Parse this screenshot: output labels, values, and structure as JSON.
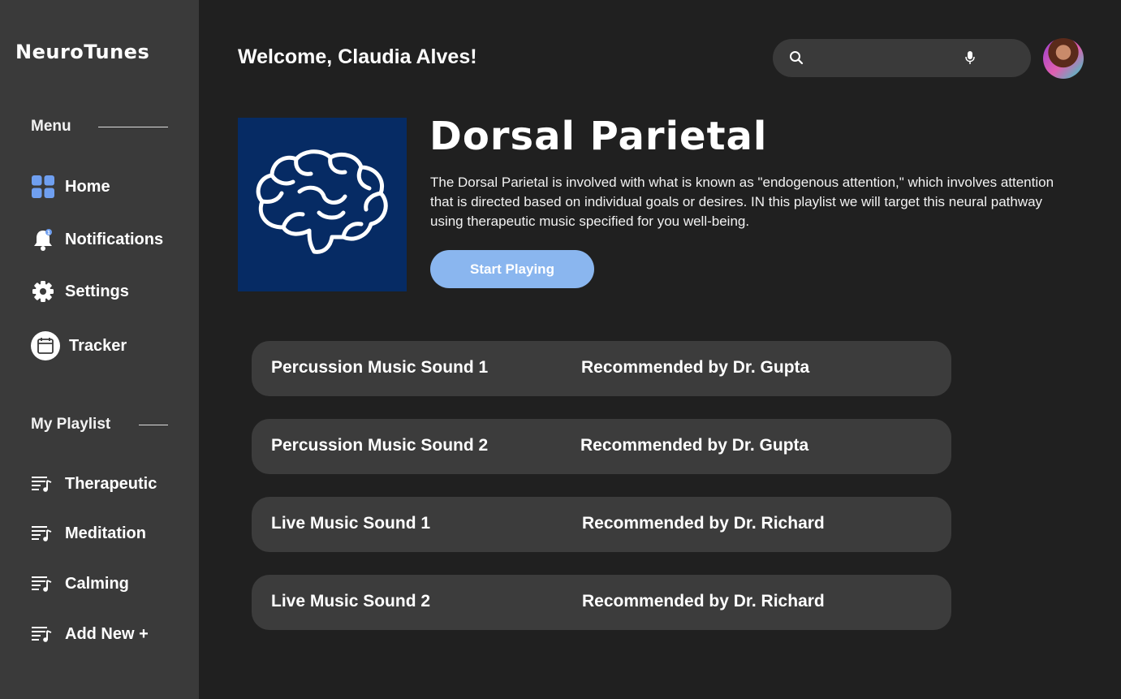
{
  "app": {
    "name": "NeuroTunes"
  },
  "sidebar": {
    "menu_label": "Menu",
    "menu_items": [
      {
        "label": "Home",
        "icon": "grid-icon"
      },
      {
        "label": "Notifications",
        "icon": "bell-icon"
      },
      {
        "label": "Settings",
        "icon": "gear-icon"
      },
      {
        "label": "Tracker",
        "icon": "calendar-icon"
      }
    ],
    "playlist_label": "My Playlist",
    "playlist_items": [
      {
        "label": "Therapeutic",
        "icon": "playlist-icon"
      },
      {
        "label": "Meditation",
        "icon": "playlist-icon"
      },
      {
        "label": "Calming",
        "icon": "playlist-icon"
      },
      {
        "label": "Add New +",
        "icon": "playlist-icon"
      }
    ]
  },
  "header": {
    "welcome": "Welcome, Claudia Alves!",
    "search_placeholder": "",
    "avatar": "user-avatar"
  },
  "hero": {
    "title": "Dorsal Parietal",
    "description": "The Dorsal Parietal is involved with what is known as \"endogenous attention,\" which involves attention that is directed based on individual goals or desires. IN this playlist we will target this neural pathway using therapeutic music specified for you well-being.",
    "play_label": "Start Playing",
    "cover_icon": "brain-icon"
  },
  "tracks": [
    {
      "name": "Percussion Music Sound 1",
      "recommended": "Recommended by Dr. Gupta"
    },
    {
      "name": "Percussion Music Sound 2",
      "recommended": "Recommended by Dr. Gupta"
    },
    {
      "name": "Live Music Sound 1",
      "recommended": "Recommended by Dr. Richard"
    },
    {
      "name": "Live Music Sound 2",
      "recommended": "Recommended by Dr. Richard"
    }
  ],
  "colors": {
    "background": "#202020",
    "sidebar": "#3a3a3a",
    "accent": "#8ab6ef",
    "cover": "#062b64",
    "track_row": "#3c3c3c"
  }
}
